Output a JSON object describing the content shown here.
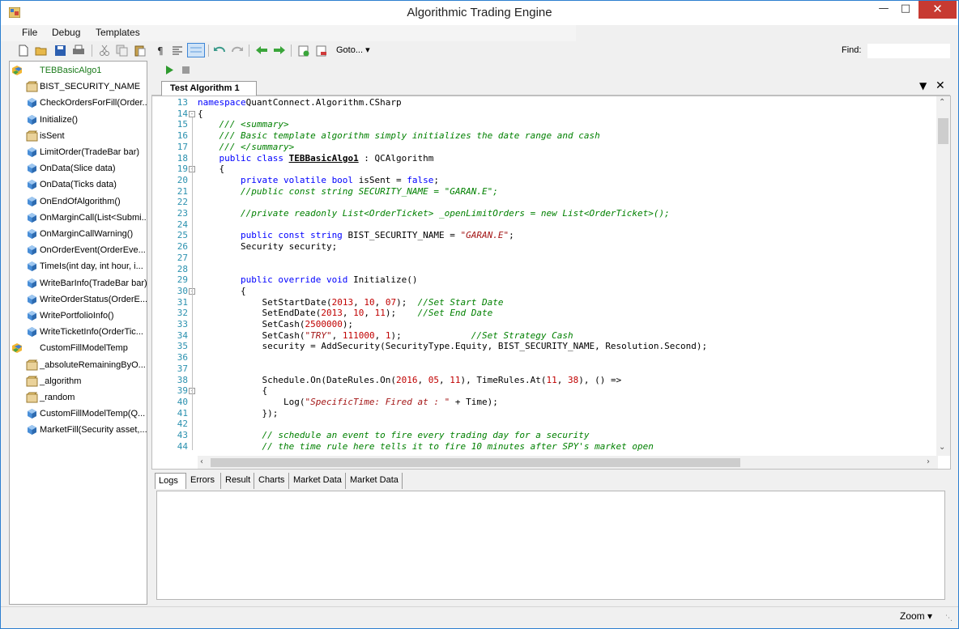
{
  "window": {
    "title": "Algorithmic Trading Engine"
  },
  "menu": {
    "items": [
      "File",
      "Debug",
      "Templates"
    ]
  },
  "toolbar": {
    "goto_label": "Goto...",
    "find_label": "Find:",
    "find_value": ""
  },
  "tree": {
    "items": [
      {
        "label": "TEBBasicAlgo1",
        "icon": "class-icon",
        "level": 0,
        "highlight": true
      },
      {
        "label": "BIST_SECURITY_NAME",
        "icon": "field-icon",
        "level": 1
      },
      {
        "label": "CheckOrdersForFill(Order...",
        "icon": "method-icon",
        "level": 1
      },
      {
        "label": "Initialize()",
        "icon": "method-icon",
        "level": 1
      },
      {
        "label": "isSent",
        "icon": "field-icon",
        "level": 1
      },
      {
        "label": "LimitOrder(TradeBar bar)",
        "icon": "method-icon",
        "level": 1
      },
      {
        "label": "OnData(Slice data)",
        "icon": "method-icon",
        "level": 1
      },
      {
        "label": "OnData(Ticks data)",
        "icon": "method-icon",
        "level": 1
      },
      {
        "label": "OnEndOfAlgorithm()",
        "icon": "method-icon",
        "level": 1
      },
      {
        "label": "OnMarginCall(List<Submi...",
        "icon": "method-icon",
        "level": 1
      },
      {
        "label": "OnMarginCallWarning()",
        "icon": "method-icon",
        "level": 1
      },
      {
        "label": "OnOrderEvent(OrderEve...",
        "icon": "method-icon",
        "level": 1
      },
      {
        "label": "TimeIs(int day, int hour, i...",
        "icon": "method-icon",
        "level": 1
      },
      {
        "label": "WriteBarInfo(TradeBar bar)",
        "icon": "method-icon",
        "level": 1
      },
      {
        "label": "WriteOrderStatus(OrderE...",
        "icon": "method-icon",
        "level": 1
      },
      {
        "label": "WritePortfolioInfo()",
        "icon": "method-icon",
        "level": 1
      },
      {
        "label": "WriteTicketInfo(OrderTic...",
        "icon": "method-icon",
        "level": 1
      },
      {
        "label": "CustomFillModelTemp",
        "icon": "class-icon",
        "level": 0
      },
      {
        "label": "_absoluteRemainingByO...",
        "icon": "field-icon",
        "level": 1
      },
      {
        "label": "_algorithm",
        "icon": "field-icon",
        "level": 1
      },
      {
        "label": "_random",
        "icon": "field-icon",
        "level": 1
      },
      {
        "label": "CustomFillModelTemp(Q...",
        "icon": "method-icon",
        "level": 1
      },
      {
        "label": "MarketFill(Security asset,...",
        "icon": "method-icon",
        "level": 1
      }
    ]
  },
  "editor": {
    "tab_label": "Test Algorithm 1",
    "lines": [
      {
        "n": "13",
        "tokens": [
          [
            "kw",
            "namespace"
          ],
          [
            "",
            "QuantConnect.Algorithm.CSharp"
          ]
        ]
      },
      {
        "n": "14",
        "fold": "-",
        "tokens": [
          [
            "",
            "{"
          ]
        ]
      },
      {
        "n": "15",
        "tokens": [
          [
            "cm",
            "    /// <summary>"
          ]
        ]
      },
      {
        "n": "16",
        "tokens": [
          [
            "cm",
            "    /// Basic template algorithm simply initializes the date range and cash"
          ]
        ]
      },
      {
        "n": "17",
        "tokens": [
          [
            "cm",
            "    /// </summary>"
          ]
        ]
      },
      {
        "n": "18",
        "tokens": [
          [
            "kw",
            "    public class "
          ],
          [
            "ty",
            "TEBBasicAlgo1"
          ],
          [
            "",
            " : QCAlgorithm"
          ]
        ]
      },
      {
        "n": "19",
        "fold": "-",
        "tokens": [
          [
            "",
            "    {"
          ]
        ]
      },
      {
        "n": "20",
        "tokens": [
          [
            "kw",
            "        private volatile bool "
          ],
          [
            "",
            "isSent = "
          ],
          [
            "kw",
            "false"
          ],
          [
            "",
            ";"
          ]
        ]
      },
      {
        "n": "21",
        "tokens": [
          [
            "cm",
            "        //public const string SECURITY_NAME = \"GARAN.E\";"
          ]
        ]
      },
      {
        "n": "22",
        "tokens": []
      },
      {
        "n": "23",
        "tokens": [
          [
            "cm",
            "        //private readonly List<OrderTicket> _openLimitOrders = new List<OrderTicket>();"
          ]
        ]
      },
      {
        "n": "24",
        "tokens": []
      },
      {
        "n": "25",
        "tokens": [
          [
            "kw",
            "        public const string "
          ],
          [
            "",
            "BIST_SECURITY_NAME = "
          ],
          [
            "st",
            "\"GARAN.E\""
          ],
          [
            "",
            ";"
          ]
        ]
      },
      {
        "n": "26",
        "tokens": [
          [
            "",
            "        Security security;"
          ]
        ]
      },
      {
        "n": "27",
        "tokens": []
      },
      {
        "n": "28",
        "tokens": []
      },
      {
        "n": "29",
        "tokens": [
          [
            "kw",
            "        public override void "
          ],
          [
            "",
            "Initialize()"
          ]
        ]
      },
      {
        "n": "30",
        "fold": "-",
        "tokens": [
          [
            "",
            "        {"
          ]
        ]
      },
      {
        "n": "31",
        "tokens": [
          [
            "",
            "            SetStartDate("
          ],
          [
            "nm",
            "2013"
          ],
          [
            "",
            ", "
          ],
          [
            "nm",
            "10"
          ],
          [
            "",
            ", "
          ],
          [
            "nm",
            "07"
          ],
          [
            "",
            ");  "
          ],
          [
            "cm",
            "//Set Start Date"
          ]
        ]
      },
      {
        "n": "32",
        "tokens": [
          [
            "",
            "            SetEndDate("
          ],
          [
            "nm",
            "2013"
          ],
          [
            "",
            ", "
          ],
          [
            "nm",
            "10"
          ],
          [
            "",
            ", "
          ],
          [
            "nm",
            "11"
          ],
          [
            "",
            ");    "
          ],
          [
            "cm",
            "//Set End Date"
          ]
        ]
      },
      {
        "n": "33",
        "tokens": [
          [
            "",
            "            SetCash("
          ],
          [
            "nm",
            "2500000"
          ],
          [
            "",
            ");"
          ]
        ]
      },
      {
        "n": "34",
        "tokens": [
          [
            "",
            "            SetCash("
          ],
          [
            "st",
            "\"TRY\""
          ],
          [
            "",
            ", "
          ],
          [
            "nm",
            "111000"
          ],
          [
            "",
            ", "
          ],
          [
            "nm",
            "1"
          ],
          [
            "",
            ");             "
          ],
          [
            "cm",
            "//Set Strategy Cash"
          ]
        ]
      },
      {
        "n": "35",
        "tokens": [
          [
            "",
            "            security = AddSecurity(SecurityType.Equity, BIST_SECURITY_NAME, Resolution.Second);"
          ]
        ]
      },
      {
        "n": "36",
        "tokens": []
      },
      {
        "n": "37",
        "tokens": []
      },
      {
        "n": "38",
        "tokens": [
          [
            "",
            "            Schedule.On(DateRules.On("
          ],
          [
            "nm",
            "2016"
          ],
          [
            "",
            ", "
          ],
          [
            "nm",
            "05"
          ],
          [
            "",
            ", "
          ],
          [
            "nm",
            "11"
          ],
          [
            "",
            "), TimeRules.At("
          ],
          [
            "nm",
            "11"
          ],
          [
            "",
            ", "
          ],
          [
            "nm",
            "38"
          ],
          [
            "",
            "), () =>"
          ]
        ]
      },
      {
        "n": "39",
        "fold": "-",
        "tokens": [
          [
            "",
            "            {"
          ]
        ]
      },
      {
        "n": "40",
        "tokens": [
          [
            "",
            "                Log("
          ],
          [
            "st",
            "\"SpecificTime: Fired at : \""
          ],
          [
            "",
            " + Time);"
          ]
        ]
      },
      {
        "n": "41",
        "tokens": [
          [
            "",
            "            });"
          ]
        ]
      },
      {
        "n": "42",
        "tokens": []
      },
      {
        "n": "43",
        "tokens": [
          [
            "cm",
            "            // schedule an event to fire every trading day for a security"
          ]
        ]
      },
      {
        "n": "44",
        "tokens": [
          [
            "cm",
            "            // the time rule here tells it to fire 10 minutes after SPY's market open"
          ]
        ]
      }
    ]
  },
  "bottom_tabs": [
    "Logs",
    "Errors",
    "Result",
    "Charts",
    "Market Data",
    "Market Data"
  ],
  "status": {
    "zoom_label": "Zoom"
  }
}
